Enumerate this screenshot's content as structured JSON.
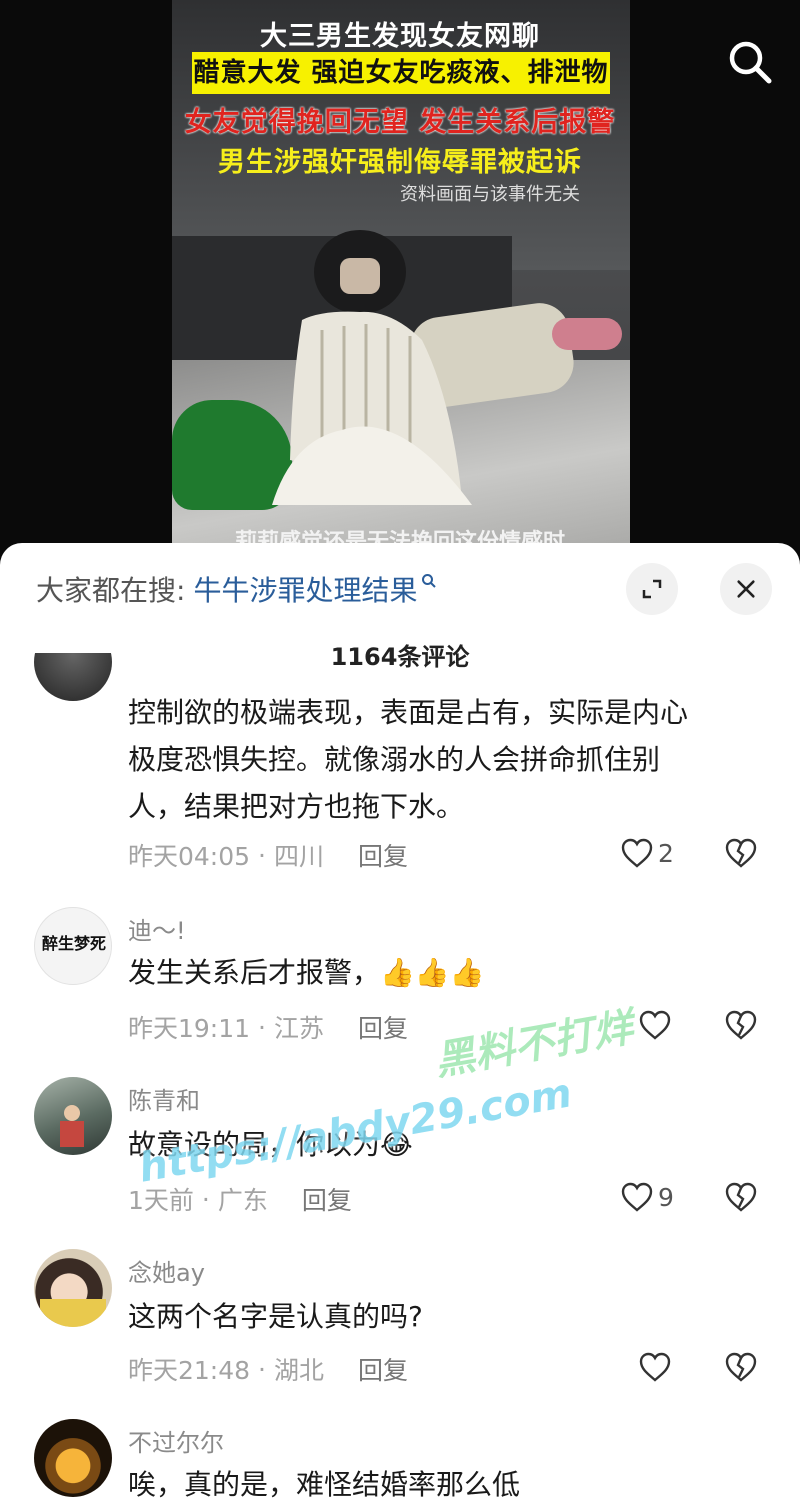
{
  "video": {
    "headline_1": "大三男生发现女友网聊",
    "headline_2": "醋意大发 强迫女友吃痰液、排泄物",
    "headline_3": "女友觉得挽回无望 发生关系后报警",
    "headline_4": "男生涉强奸强制侮辱罪被起诉",
    "disclaimer": "资料画面与该事件无关",
    "subtitle": "莉莉感觉还是无法挽回这份情感时",
    "search_icon": "search-icon"
  },
  "sheet": {
    "search_prefix": "大家都在搜:",
    "search_query": "牛牛涉罪处理结果",
    "comment_count": "1164条评论",
    "expand_icon": "expand-icon",
    "close_icon": "close-icon"
  },
  "comments": [
    {
      "user": "",
      "text_lines": [
        "控制欲的极端表现，表面是占有，实际是内心",
        "极度恐惧失控。就像溺水的人会拼命抓住别",
        "人，结果把对方也拖下水。"
      ],
      "time": "昨天04:05",
      "location": "四川",
      "reply": "回复",
      "likes": "2"
    },
    {
      "user": "迪～!",
      "text": "发生关系后才报警，",
      "emoji": "👍👍👍",
      "time": "昨天19:11",
      "location": "江苏",
      "reply": "回复",
      "likes": ""
    },
    {
      "user": "陈青和",
      "text": "故意设的局，你以为",
      "emoji": "😂",
      "time": "1天前",
      "location": "广东",
      "reply": "回复",
      "likes": "9"
    },
    {
      "user": "念她ay",
      "text": "这两个名字是认真的吗?",
      "time": "昨天21:48",
      "location": "湖北",
      "reply": "回复",
      "likes": ""
    },
    {
      "user": "不过尔尔",
      "text": "唉，真的是，难怪结婚率那么低"
    }
  ],
  "avatar_2_logo": "醉生梦死",
  "watermark": {
    "line1": "黑料不打烊",
    "line2": "https://abdy29.com"
  },
  "colors": {
    "link": "#2a5d9a",
    "yellow_banner": "#f7f100",
    "red_headline": "#e0241f"
  }
}
